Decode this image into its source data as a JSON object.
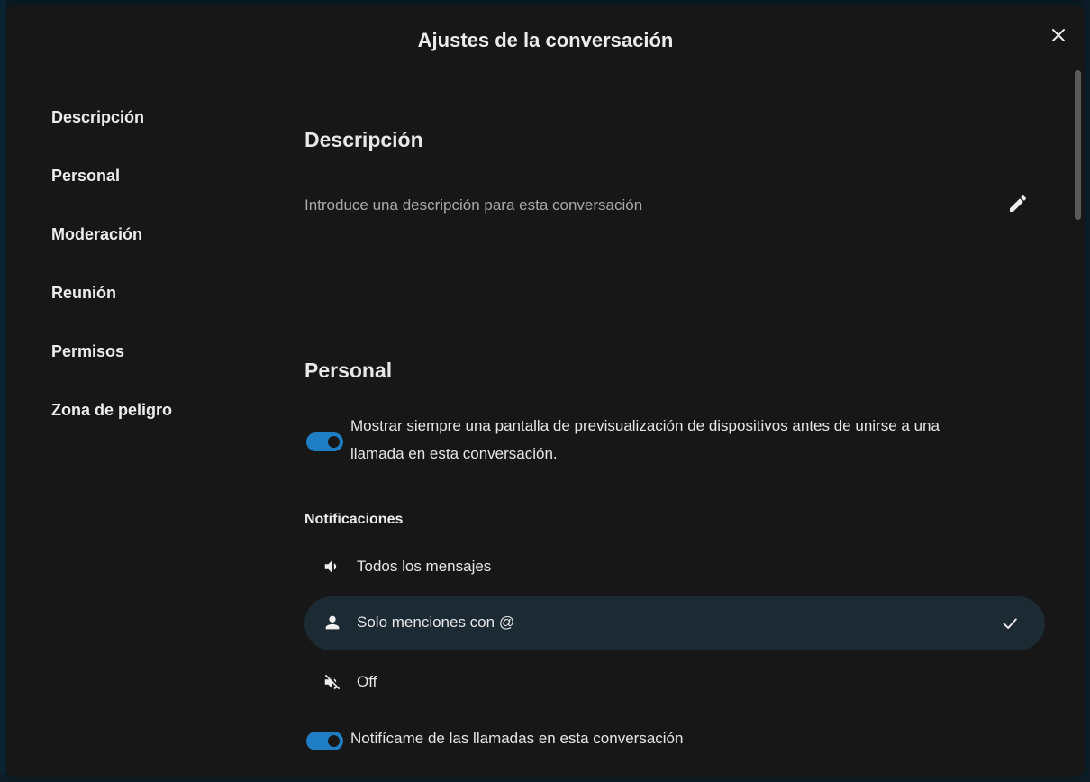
{
  "dialog": {
    "title": "Ajustes de la conversación"
  },
  "nav": {
    "items": [
      {
        "label": "Descripción"
      },
      {
        "label": "Personal"
      },
      {
        "label": "Moderación"
      },
      {
        "label": "Reunión"
      },
      {
        "label": "Permisos"
      },
      {
        "label": "Zona de peligro"
      }
    ]
  },
  "description": {
    "title": "Descripción",
    "placeholder": "Introduce una descripción para esta conversación",
    "edit_icon": "pencil-icon"
  },
  "personal": {
    "title": "Personal",
    "device_preview": {
      "label_line1": "Mostrar siempre una pantalla de previsualización de dispositivos antes de unirse a una",
      "label_line2": "llamada en esta conversación.",
      "enabled": true
    },
    "notifications": {
      "title": "Notificaciones",
      "options": [
        {
          "label": "Todos los mensajes",
          "icon": "volume-icon",
          "selected": false
        },
        {
          "label": "Solo menciones con @",
          "icon": "account-icon",
          "selected": true
        },
        {
          "label": "Off",
          "icon": "volume-off-icon",
          "selected": false
        }
      ]
    },
    "call_notifications": {
      "label": "Notifícame de las llamadas en esta conversación",
      "enabled": true
    }
  },
  "colors": {
    "accent": "#1f7dc3",
    "modal_bg": "#171717",
    "selected_bg": "#1c2a34"
  }
}
